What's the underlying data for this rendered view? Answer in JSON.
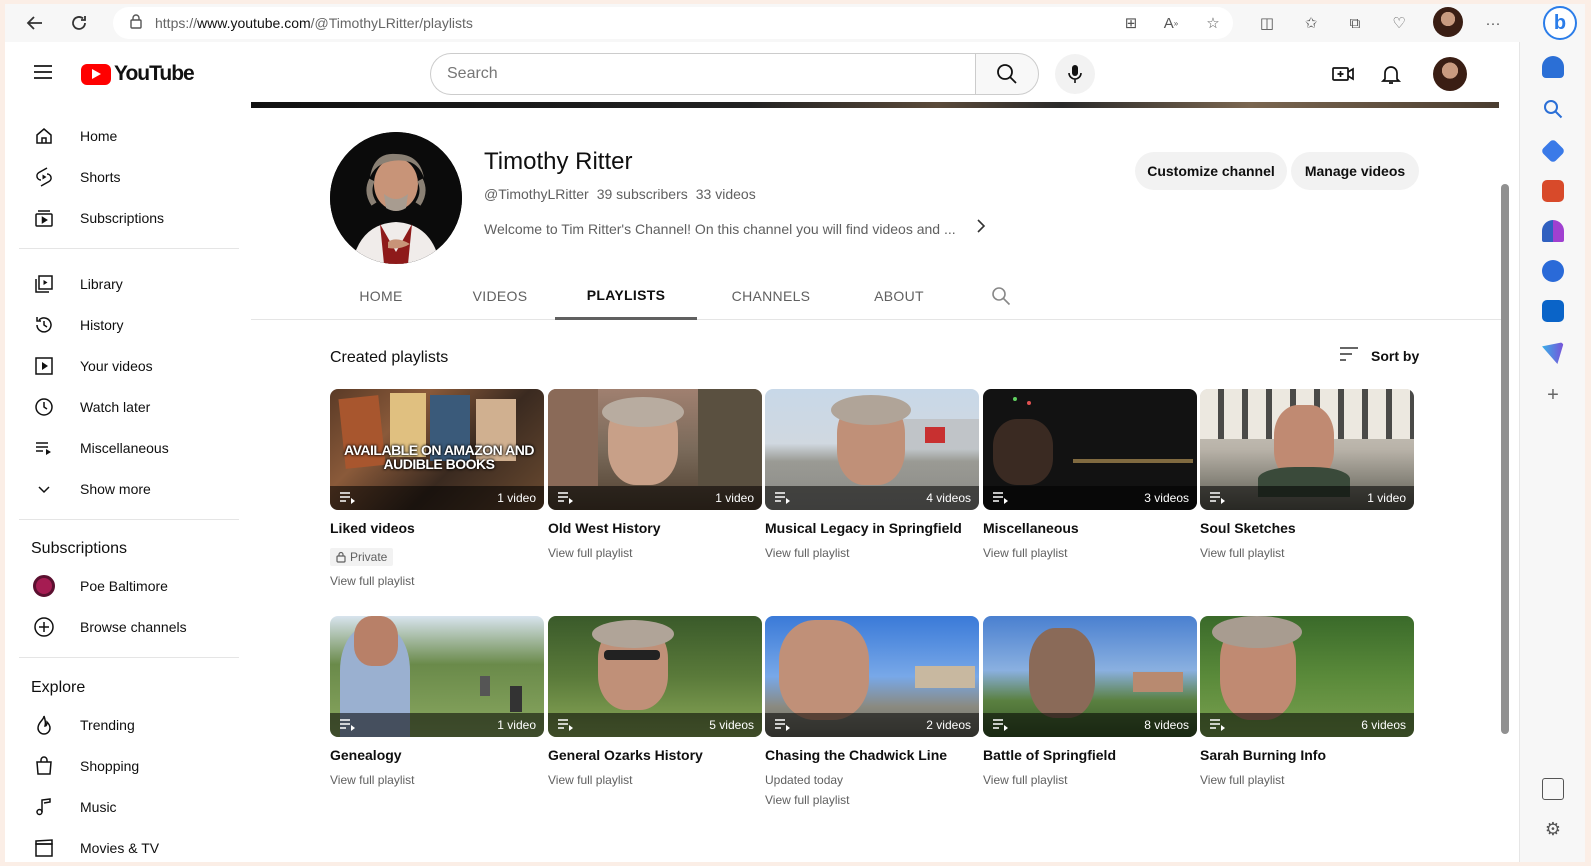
{
  "browser": {
    "url_prefix": "https://",
    "url_domain": "www.youtube.com",
    "url_path": "/@TimothyLRitter/playlists",
    "bing_label": "b"
  },
  "header": {
    "logo_text": "YouTube",
    "search_placeholder": "Search"
  },
  "sidebar": {
    "main": [
      {
        "label": "Home",
        "icon": "home-icon"
      },
      {
        "label": "Shorts",
        "icon": "shorts-icon"
      },
      {
        "label": "Subscriptions",
        "icon": "subscriptions-icon"
      }
    ],
    "library": [
      {
        "label": "Library",
        "icon": "library-icon"
      },
      {
        "label": "History",
        "icon": "history-icon"
      },
      {
        "label": "Your videos",
        "icon": "your-videos-icon"
      },
      {
        "label": "Watch later",
        "icon": "watch-later-icon"
      },
      {
        "label": "Miscellaneous",
        "icon": "playlist-icon"
      },
      {
        "label": "Show more",
        "icon": "chevron-down-icon"
      }
    ],
    "subscriptions_heading": "Subscriptions",
    "subscriptions": [
      {
        "label": "Poe Baltimore",
        "icon": "channel-avatar"
      },
      {
        "label": "Browse channels",
        "icon": "add-circle-icon"
      }
    ],
    "explore_heading": "Explore",
    "explore": [
      {
        "label": "Trending",
        "icon": "trending-icon"
      },
      {
        "label": "Shopping",
        "icon": "shopping-icon"
      },
      {
        "label": "Music",
        "icon": "music-icon"
      },
      {
        "label": "Movies & TV",
        "icon": "movies-icon"
      }
    ]
  },
  "channel": {
    "name": "Timothy Ritter",
    "handle": "@TimothyLRitter",
    "subscribers": "39 subscribers",
    "videos": "33 videos",
    "description": "Welcome to Tim Ritter's Channel! On this channel you will find videos and ...",
    "customize_label": "Customize channel",
    "manage_label": "Manage videos"
  },
  "tabs": [
    {
      "label": "HOME",
      "active": false
    },
    {
      "label": "VIDEOS",
      "active": false
    },
    {
      "label": "PLAYLISTS",
      "active": true
    },
    {
      "label": "CHANNELS",
      "active": false
    },
    {
      "label": "ABOUT",
      "active": false
    }
  ],
  "section": {
    "title": "Created playlists",
    "sort_label": "Sort by"
  },
  "playlists": [
    {
      "title": "Liked videos",
      "count": "1 video",
      "private_label": "Private",
      "link": "View full playlist",
      "overlay_text": "AVAILABLE ON AMAZON AND AUDIBLE BOOKS"
    },
    {
      "title": "Old West History",
      "count": "1 video",
      "link": "View full playlist"
    },
    {
      "title": "Musical Legacy in Springfield",
      "count": "4 videos",
      "link": "View full playlist"
    },
    {
      "title": "Miscellaneous",
      "count": "3 videos",
      "link": "View full playlist"
    },
    {
      "title": "Soul Sketches",
      "count": "1 video",
      "link": "View full playlist"
    },
    {
      "title": "Genealogy",
      "count": "1 video",
      "link": "View full playlist"
    },
    {
      "title": "General Ozarks History",
      "count": "5 videos",
      "link": "View full playlist"
    },
    {
      "title": "Chasing the Chadwick Line",
      "count": "2 videos",
      "updated": "Updated today",
      "link": "View full playlist"
    },
    {
      "title": "Battle of Springfield",
      "count": "8 videos",
      "link": "View full playlist"
    },
    {
      "title": "Sarah Burning Info",
      "count": "6 videos",
      "link": "View full playlist"
    }
  ],
  "colors": {
    "brand_red": "#ff0000",
    "text_primary": "#0f0f0f",
    "text_secondary": "#606060",
    "pill_bg": "#f2f2f2"
  }
}
